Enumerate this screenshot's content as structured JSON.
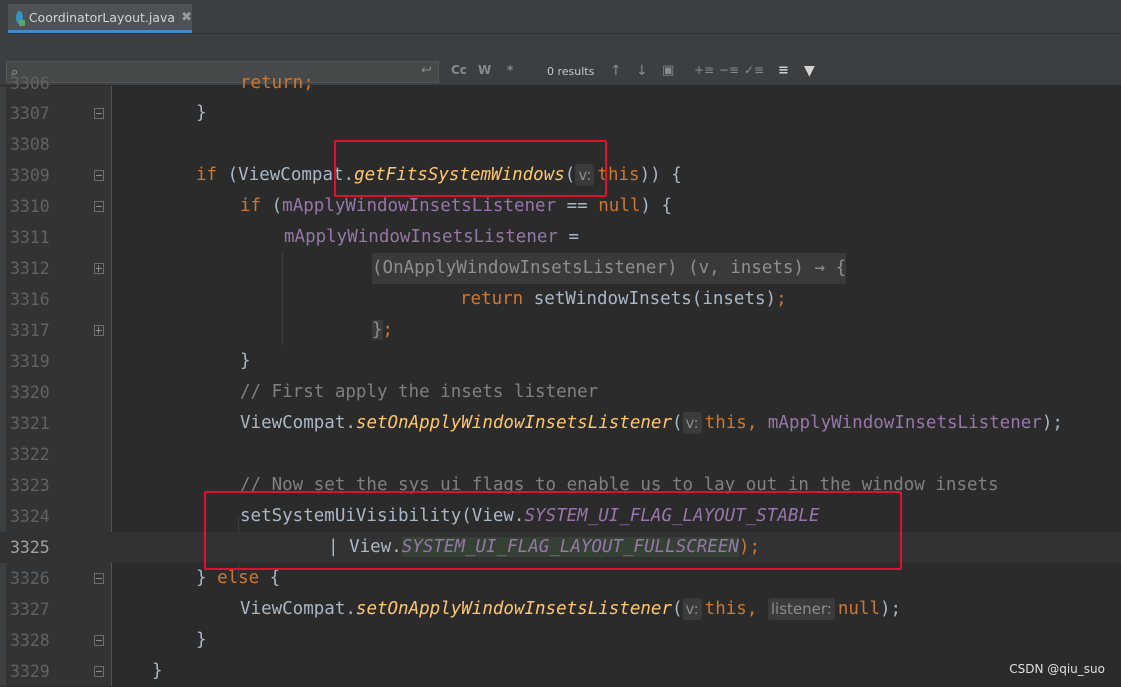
{
  "editor_tab": {
    "title": "CoordinatorLayout.java",
    "close": "✖"
  },
  "find_bar": {
    "placeholder": "",
    "search_icon": "⌕",
    "case_label": "Cc",
    "word_label": "W",
    "regex_label": "*",
    "results_text": "0 results"
  },
  "code_lines": [
    {
      "num": "3306",
      "text": "            return;"
    },
    {
      "num": "3307",
      "text": "        }"
    },
    {
      "num": "3308",
      "text": ""
    },
    {
      "num": "3309",
      "text": "        if (ViewCompat.getFitsSystemWindows( v: this)) {"
    },
    {
      "num": "3310",
      "text": "            if (mApplyWindowInsetsListener == null) {"
    },
    {
      "num": "3311",
      "text": "                mApplyWindowInsetsListener ="
    },
    {
      "num": "3312",
      "text": "                        (OnApplyWindowInsetsListener) (v, insets) → {"
    },
    {
      "num": "3316",
      "text": "                            return setWindowInsets(insets);"
    },
    {
      "num": "3317",
      "text": "                        };"
    },
    {
      "num": "3319",
      "text": "            }"
    },
    {
      "num": "3320",
      "text": "            // First apply the insets listener"
    },
    {
      "num": "3321",
      "text": "            ViewCompat.setOnApplyWindowInsetsListener( v: this, mApplyWindowInsetsListener);"
    },
    {
      "num": "3322",
      "text": ""
    },
    {
      "num": "3323",
      "text": "            // Now set the sys ui flags to enable us to lay out in the window insets"
    },
    {
      "num": "3324",
      "text": "            setSystemUiVisibility(View.SYSTEM_UI_FLAG_LAYOUT_STABLE"
    },
    {
      "num": "3325",
      "text": "                    | View.SYSTEM_UI_FLAG_LAYOUT_FULLSCREEN);"
    },
    {
      "num": "3326",
      "text": "        } else {"
    },
    {
      "num": "3327",
      "text": "            ViewCompat.setOnApplyWindowInsetsListener( v: this,  listener: null);"
    },
    {
      "num": "3328",
      "text": "        }"
    },
    {
      "num": "3329",
      "text": "    }"
    }
  ],
  "tokens": {
    "t3306": "return;",
    "t3307": "}",
    "t3309_if": "if",
    "t3309_a": "(ViewCompat.",
    "t3309_m": "getFitsSystemWindows",
    "t3309_p": "(",
    "t3309_hint": "v:",
    "t3309_this": "this",
    "t3309_end": ")) {",
    "t3310_if": "if",
    "t3310_a": "(",
    "t3310_f": "mApplyWindowInsetsListener",
    "t3310_b": " == ",
    "t3310_null": "null",
    "t3310_c": ") {",
    "t3311_f": "mApplyWindowInsetsListener",
    "t3311_eq": " =",
    "t3312_lam": "(OnApplyWindowInsetsListener) (v, insets) → {",
    "t3316_ret": "return",
    "t3316_rest": " setWindowInsets(insets)",
    "t3316_semi": ";",
    "t3317_b": "}",
    "t3317_semi": ";",
    "t3319": "}",
    "t3320": "// First apply the insets listener",
    "t3321_a": "ViewCompat.",
    "t3321_m": "setOnApplyWindowInsetsListener",
    "t3321_p": "(",
    "t3321_hint": "v:",
    "t3321_this": "this",
    "t3321_c": ", ",
    "t3321_f": "mApplyWindowInsetsListener",
    "t3321_end": ");",
    "t3323": "// Now set the sys ui flags to enable us to lay out in the window insets",
    "t3324_a": "setSystemUiVisibility(View.",
    "t3324_f": "SYSTEM_UI_FLAG_LAYOUT_STABLE",
    "t3325_a": "| View.",
    "t3325_f": "SYSTEM_UI_FLAG_LAYOUT_FULLSCREEN",
    "t3325_end": ");",
    "t3326_a": "} ",
    "t3326_else": "else",
    "t3326_b": " {",
    "t3327_a": "ViewCompat.",
    "t3327_m": "setOnApplyWindowInsetsListener",
    "t3327_p": "(",
    "t3327_hint": "v:",
    "t3327_this": "this",
    "t3327_c": ", ",
    "t3327_hint2": "listener:",
    "t3327_null": "null",
    "t3327_end": ");",
    "t3328": "}",
    "t3329": "}"
  },
  "watermark": "CSDN @qiu_suo",
  "colors": {
    "background": "#2b2b2b",
    "keyword": "#cc7832",
    "field": "#9876aa",
    "method": "#ffc66d",
    "comment": "#808080",
    "annotation_box": "#e1102d"
  }
}
